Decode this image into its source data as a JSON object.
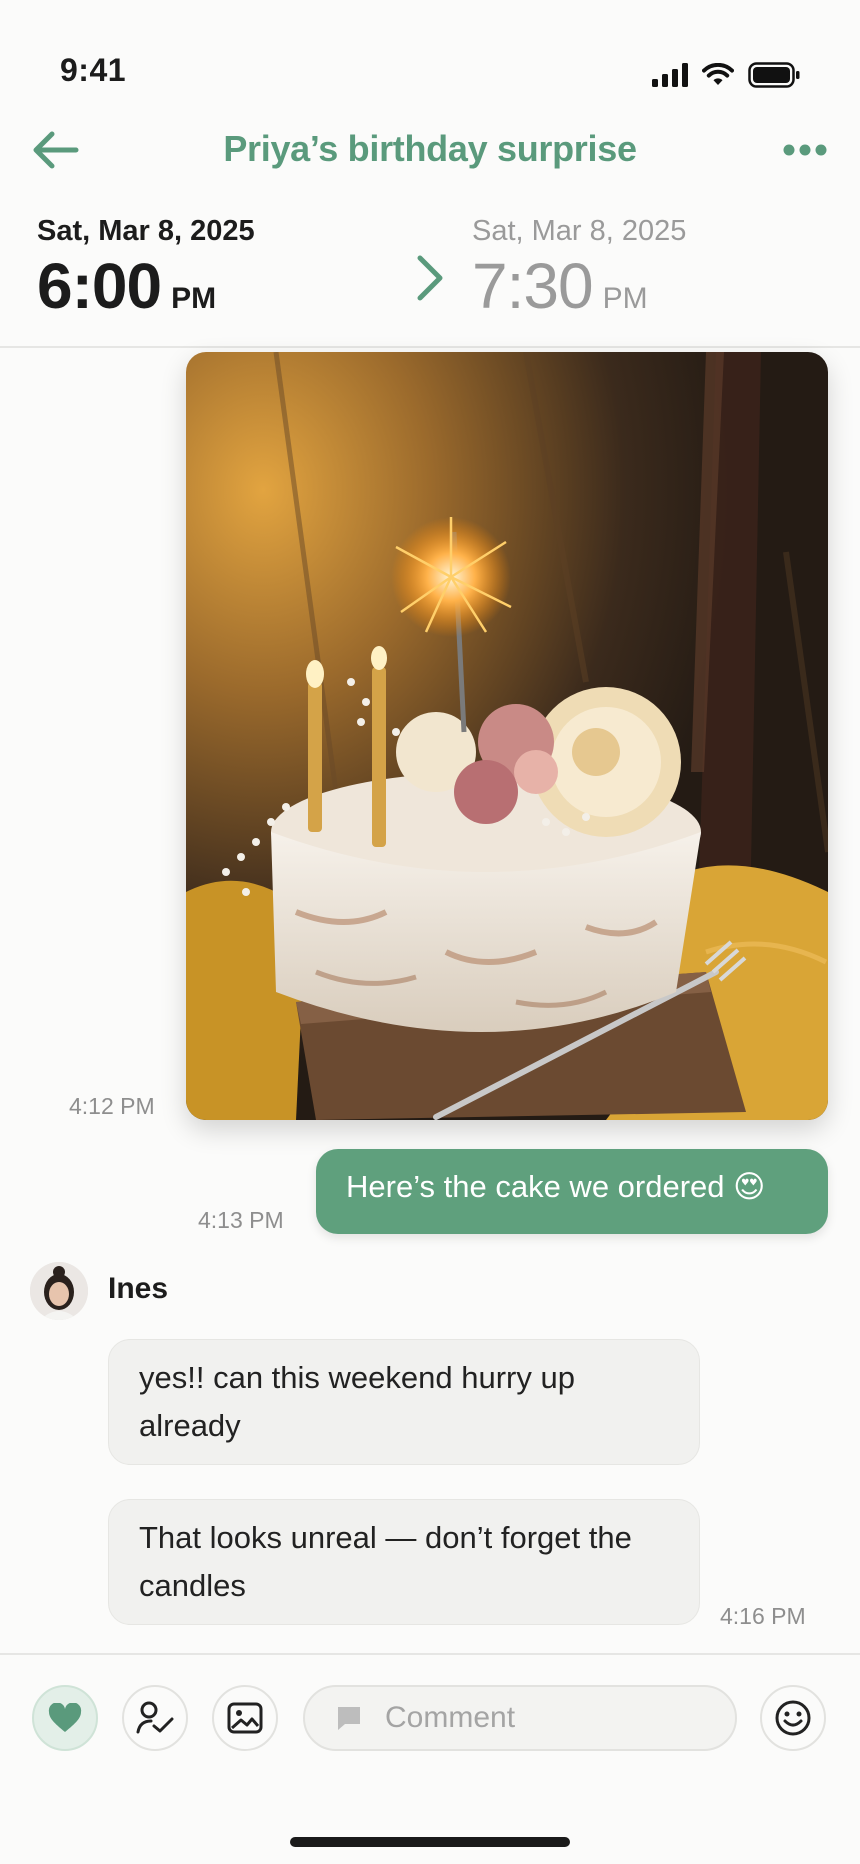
{
  "status_bar": {
    "time": "9:41"
  },
  "header": {
    "title": "Priya’s birthday surprise",
    "back_icon": "arrow-left-icon",
    "more_icon": "ellipsis-icon",
    "accent_color": "#5a9a7c"
  },
  "date_range": {
    "start": {
      "date": "Sat, Mar 8, 2025",
      "time": "6:00",
      "ampm": "PM"
    },
    "end": {
      "date": "Sat, Mar 8, 2025",
      "time": "7:30",
      "ampm": "PM"
    }
  },
  "messages": [
    {
      "type": "image",
      "timestamp": "4:12 PM",
      "alt_subject": "birthday cake with candles and sparkler"
    },
    {
      "type": "text",
      "from_me": true,
      "text": "Here’s the cake we ordered 😍",
      "timestamp": "4:13 PM",
      "color": "#5fa07d"
    },
    {
      "type": "sender",
      "name": "Ines"
    },
    {
      "type": "text",
      "from_me": false,
      "text": "yes!! can this weekend hurry up already"
    },
    {
      "type": "text",
      "from_me": false,
      "text": "That looks unreal — don’t forget the candles",
      "timestamp": "4:16 PM"
    }
  ],
  "input_bar": {
    "heart_icon": "heart-icon",
    "assign_icon": "person-check-icon",
    "image_icon": "image-icon",
    "comment_icon": "chat-bubble-icon",
    "comment_placeholder": "Comment",
    "emoji_icon": "smiley-icon"
  }
}
